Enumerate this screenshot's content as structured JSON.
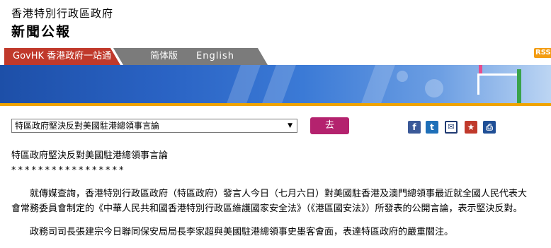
{
  "header": {
    "title": "香港特別行政區政府",
    "subtitle": "新聞公報"
  },
  "nav": {
    "govhk": "GovHK 香港政府一站通",
    "simplified": "简体版",
    "english": "English",
    "rss": "RSS"
  },
  "toolbar": {
    "select_value": "特區政府堅決反對美國駐港總領事言論",
    "go_label": "去"
  },
  "share": {
    "facebook": "f",
    "twitter": "t",
    "email": "✉",
    "bookmark": "★",
    "print": "⎙"
  },
  "article": {
    "headline": "特區政府堅決反對美國駐港總領事言論",
    "stars": "*****************",
    "paragraphs": [
      "就傳媒查詢，香港特別行政區政府（特區政府）發言人今日（七月六日）對美國駐香港及澳門總領事最近就全國人民代表大會常務委員會制定的《中華人民共和國香港特別行政區維護國家安全法》（《港區國安法》）所發表的公開言論，表示堅決反對。",
      "政務司司長張建宗今日聯同保安局局長李家超與美國駐港總領事史墨客會面，表達特區政府的嚴重關注。"
    ]
  },
  "colors": {
    "govhk_red": "#c0392b",
    "nav_gray": "#7b7b7b",
    "go_button": "#b4226e",
    "banner_blue": "#2a63c4",
    "rss_orange": "#f39c12"
  }
}
